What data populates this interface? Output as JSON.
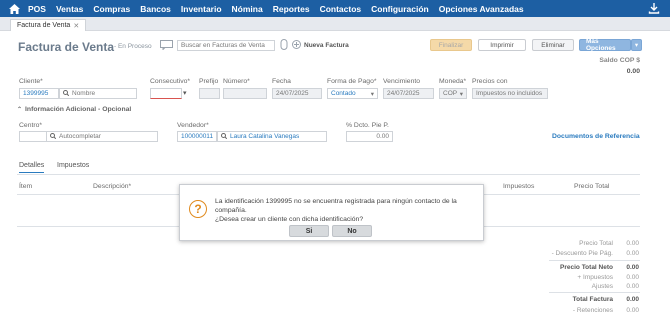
{
  "nav": {
    "items": [
      "POS",
      "Ventas",
      "Compras",
      "Bancos",
      "Inventario",
      "Nómina",
      "Reportes",
      "Contactos",
      "Configuración",
      "Opciones Avanzadas"
    ]
  },
  "tabs": [
    {
      "label": "Factura de Venta"
    }
  ],
  "header": {
    "title": "Factura de Venta",
    "status": "- En Proceso",
    "search_placeholder": "Buscar en Facturas de Venta",
    "new_invoice": "Nueva Factura",
    "finalize": "Finalizar",
    "print": "Imprimir",
    "delete": "Eliminar",
    "more_options": "Más Opciones",
    "balance_label": "Saldo COP $",
    "balance_value": "0.00"
  },
  "form": {
    "cliente_label": "Cliente*",
    "cliente_id": "1399995",
    "cliente_name_placeholder": "Nombre",
    "consecutivo_label": "Consecutivo*",
    "prefijo_label": "Prefijo",
    "numero_label": "Número*",
    "fecha_label": "Fecha",
    "fecha_value": "24/07/2025",
    "forma_pago_label": "Forma de Pago*",
    "forma_pago_value": "Contado",
    "vencimiento_label": "Vencimiento",
    "vencimiento_value": "24/07/2025",
    "moneda_label": "Moneda*",
    "moneda_value": "COP",
    "precios_label": "Precios con",
    "precios_value": "Impuestos no incluidos",
    "info_adicional": "Información Adicional - Opcional",
    "centro_label": "Centro*",
    "centro_placeholder": "Autocompletar",
    "vendedor_label": "Vendedor*",
    "vendedor_id": "100000011",
    "vendedor_name": "Laura Catalina Vanegas",
    "dcto_label": "% Dcto. Pie P.",
    "dcto_value": "0.00",
    "docs_ref": "Documentos de Referencia"
  },
  "detail_tabs": [
    "Detalles",
    "Impuestos"
  ],
  "table": {
    "headers": {
      "item": "Ítem",
      "desc": "Descripción*",
      "impuestos": "Impuestos",
      "precio_total": "Precio Total"
    }
  },
  "totals": [
    {
      "label": "Precio Total",
      "value": "0.00",
      "bold": false
    },
    {
      "label": "- Descuento Pie Pág.",
      "value": "0.00",
      "bold": false
    },
    {
      "label": "Precio Total Neto",
      "value": "0.00",
      "bold": true
    },
    {
      "label": "+ Impuestos",
      "value": "0.00",
      "bold": false
    },
    {
      "label": "Ajustes",
      "value": "0.00",
      "bold": false
    },
    {
      "label": "Total Factura",
      "value": "0.00",
      "bold": true
    },
    {
      "label": "- Retenciones",
      "value": "0.00",
      "bold": false
    }
  ],
  "dialog": {
    "line1": "La identificación 1399995 no se encuentra registrada para ningún contacto de la compañía.",
    "line2": "¿Desea crear un cliente con dicha identificación?",
    "yes": "Si",
    "no": "No"
  },
  "colors": {
    "nav": "#1d5fa3",
    "link": "#2a7bbf",
    "finalize": "#f5d9a8",
    "more": "#8fb6e0",
    "warning": "#e08a1e"
  }
}
